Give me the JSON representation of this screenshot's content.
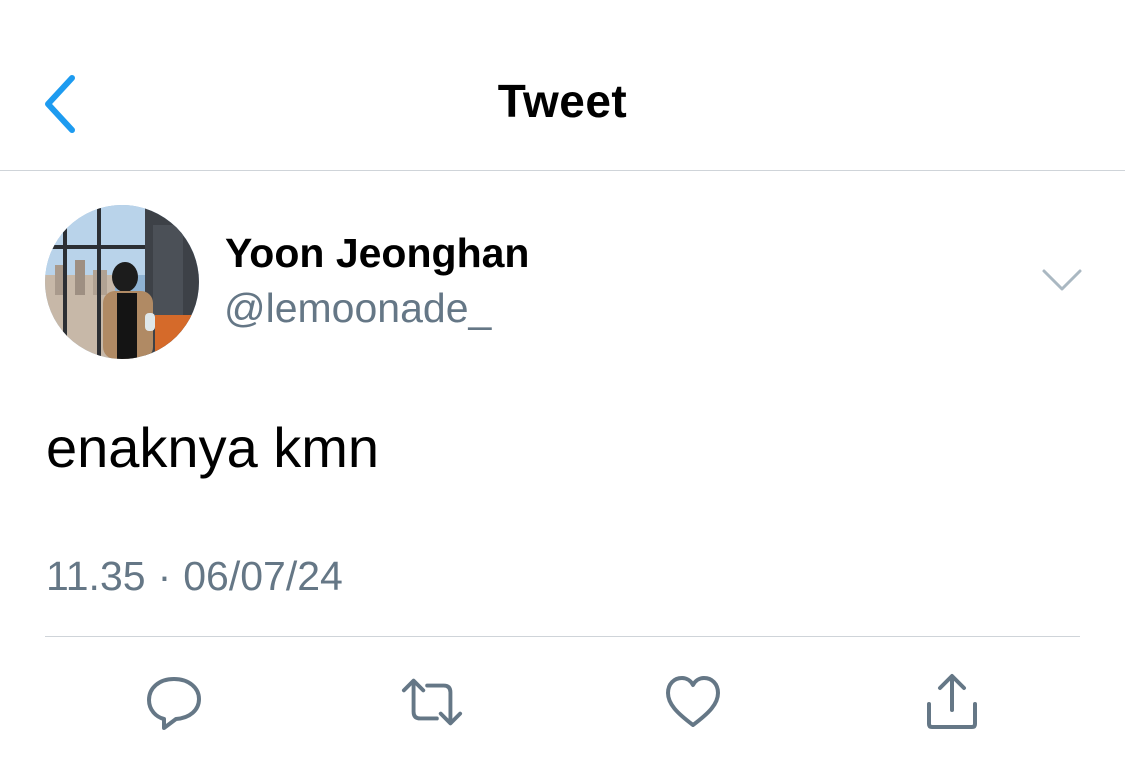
{
  "nav": {
    "title": "Tweet",
    "back_icon": "chevron-left-icon"
  },
  "tweet": {
    "author": {
      "display_name": "Yoon Jeonghan",
      "handle": "@lemoonade_"
    },
    "text": "enaknya kmn",
    "time": "11.35",
    "separator": "·",
    "date": "06/07/24"
  },
  "actions": [
    {
      "name": "reply",
      "icon": "reply-icon"
    },
    {
      "name": "retweet",
      "icon": "retweet-icon"
    },
    {
      "name": "like",
      "icon": "heart-icon"
    },
    {
      "name": "share",
      "icon": "share-icon"
    }
  ],
  "colors": {
    "accent": "#1da1f2",
    "secondary_text": "#657786",
    "icon_gray": "#657786",
    "divider": "#cfd4d9"
  }
}
